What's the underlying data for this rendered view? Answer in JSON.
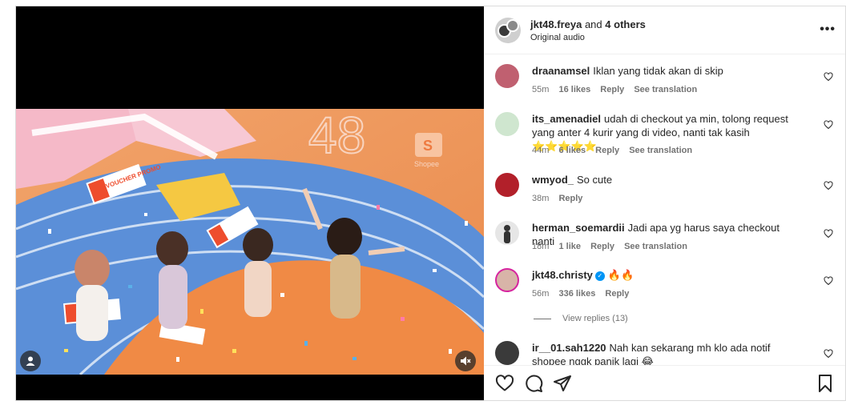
{
  "post": {
    "author": "jkt48.freya",
    "and_text": "and",
    "others": "4 others",
    "audio": "Original audio",
    "more_label": "•••"
  },
  "video": {
    "scene_texts": [
      "48",
      "Shopee",
      "VOUCHER PROMO"
    ],
    "accent_color": "#ee4d2d"
  },
  "comments": [
    {
      "user": "draanamsel",
      "text": "Iklan yang tidak akan di skip",
      "time": "55m",
      "likes": "16 likes",
      "reply": "Reply",
      "translate": "See translation",
      "avatar_color": "#c06070"
    },
    {
      "user": "its_amenadiel",
      "text": "udah di checkout ya min, tolong request yang anter 4 kurir yang di video, nanti tak kasih ⭐⭐⭐⭐⭐",
      "time": "44m",
      "likes": "6 likes",
      "reply": "Reply",
      "translate": "See translation",
      "avatar_color": "#cfe6cf"
    },
    {
      "user": "wmyod_",
      "text": "So cute",
      "time": "38m",
      "likes": "",
      "reply": "Reply",
      "translate": "",
      "avatar_color": "#b2202a"
    },
    {
      "user": "herman_soemardii",
      "text": "Jadi apa yg harus saya checkout nanti",
      "time": "18m",
      "likes": "1 like",
      "reply": "Reply",
      "translate": "See translation",
      "avatar_color": "#e6e6e6"
    },
    {
      "user": "jkt48.christy",
      "text": "🔥🔥",
      "time": "56m",
      "likes": "336 likes",
      "reply": "Reply",
      "translate": "",
      "avatar_color": "#d8b4a8",
      "verified": true
    },
    {
      "user": "ir__01.sah1220",
      "text": "Nah kan sekarang mh klo ada notif shopee nggk panik lagi 😂",
      "time": "",
      "likes": "",
      "reply": "",
      "translate": "",
      "avatar_color": "#3a3a3a"
    }
  ],
  "view_replies": "View replies (13)",
  "actions": {
    "like_icon": "heart-icon",
    "comment_icon": "comment-icon",
    "share_icon": "share-icon",
    "save_icon": "bookmark-icon"
  }
}
